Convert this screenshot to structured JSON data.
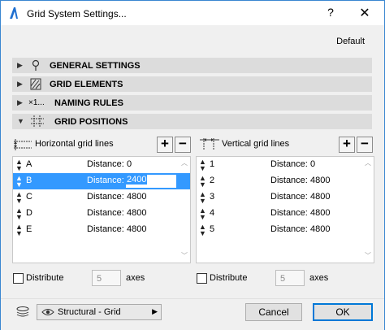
{
  "window": {
    "title": "Grid System Settings...",
    "help": "?",
    "close": "✕"
  },
  "default_label": "Default",
  "sections": [
    {
      "label": "GENERAL SETTINGS",
      "icon": "pin-icon",
      "expanded": false
    },
    {
      "label": "GRID ELEMENTS",
      "icon": "grid-element-icon",
      "expanded": false
    },
    {
      "label": "NAMING RULES",
      "icon": "naming-icon",
      "icon_text": "×1...",
      "expanded": false
    },
    {
      "label": "GRID POSITIONS",
      "icon": "grid-positions-icon",
      "expanded": true
    }
  ],
  "horizontal": {
    "header": "Horizontal grid lines",
    "add": "+",
    "remove": "−",
    "rows": [
      {
        "name": "A",
        "distance_label": "Distance:",
        "distance": "0"
      },
      {
        "name": "B",
        "distance_label": "Distance:",
        "distance": "2400"
      },
      {
        "name": "C",
        "distance_label": "Distance:",
        "distance": "4800"
      },
      {
        "name": "D",
        "distance_label": "Distance:",
        "distance": "4800"
      },
      {
        "name": "E",
        "distance_label": "Distance:",
        "distance": "4800"
      }
    ],
    "selected_index": 1,
    "distribute_label": "Distribute",
    "distribute_checked": false,
    "axes_value": "5",
    "axes_label": "axes"
  },
  "vertical": {
    "header": "Vertical grid lines",
    "add": "+",
    "remove": "−",
    "rows": [
      {
        "name": "1",
        "distance_label": "Distance:",
        "distance": "0"
      },
      {
        "name": "2",
        "distance_label": "Distance:",
        "distance": "4800"
      },
      {
        "name": "3",
        "distance_label": "Distance:",
        "distance": "4800"
      },
      {
        "name": "4",
        "distance_label": "Distance:",
        "distance": "4800"
      },
      {
        "name": "5",
        "distance_label": "Distance:",
        "distance": "4800"
      }
    ],
    "distribute_label": "Distribute",
    "distribute_checked": false,
    "axes_value": "5",
    "axes_label": "axes"
  },
  "footer": {
    "layer_combo": "Structural - Grid",
    "cancel": "Cancel",
    "ok": "OK"
  },
  "colors": {
    "accent": "#3399ff",
    "border": "#3a86d1",
    "section_bg": "#dcdcdc"
  }
}
